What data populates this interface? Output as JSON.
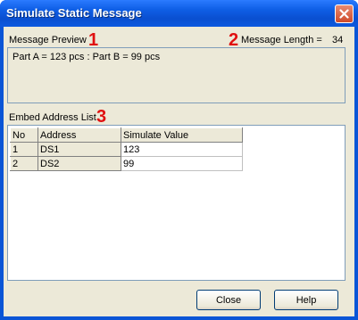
{
  "window": {
    "title": "Simulate Static Message",
    "close_glyph": "close-icon"
  },
  "preview": {
    "label": "Message Preview",
    "marker": "1",
    "text": "Part A = 123 pcs : Part B = 99 pcs"
  },
  "length": {
    "label": "Message Length =",
    "value": "34",
    "marker": "2"
  },
  "address_list": {
    "label": "Embed Address List",
    "marker": "3",
    "columns": [
      "No",
      "Address",
      "Simulate Value"
    ],
    "rows": [
      {
        "no": "1",
        "address": "DS1",
        "value": "123"
      },
      {
        "no": "2",
        "address": "DS2",
        "value": "99"
      }
    ]
  },
  "buttons": {
    "close": "Close",
    "help": "Help"
  },
  "colors": {
    "marker": "#e01010",
    "titlebar": "#0a55d6"
  }
}
